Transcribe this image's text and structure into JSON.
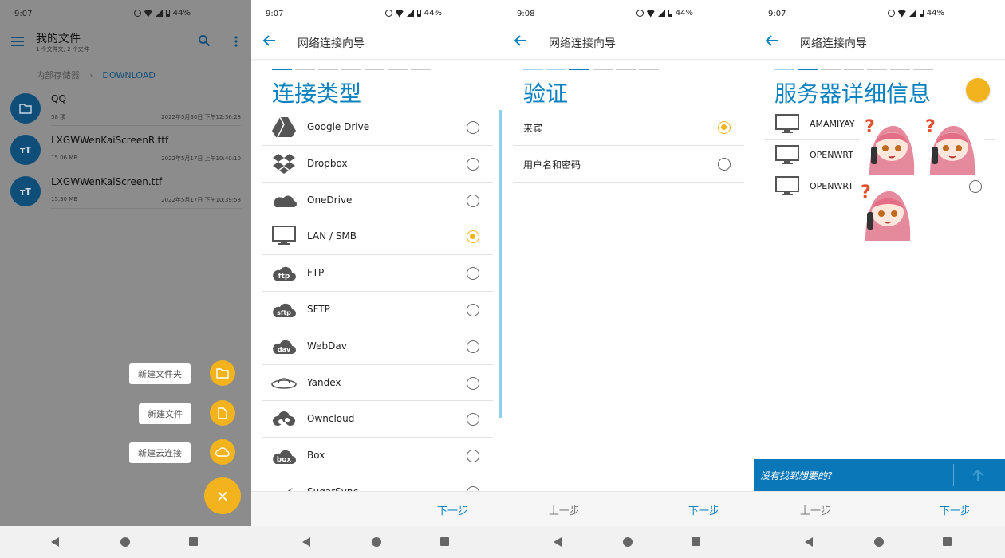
{
  "colors": {
    "accent": "#0a82c0",
    "fab": "#f2b31d",
    "hint_bar": "#0a78b8",
    "folder_icon": "#0e4e78"
  },
  "status": {
    "p1_time": "9:07",
    "p2_time": "9:07",
    "p3_time": "9:08",
    "p4_time": "9:07",
    "battery": "44%"
  },
  "panel1": {
    "title": "我的文件",
    "subtitle": "1 个文件夹, 2 个文件",
    "breadcrumb": {
      "root": "内部存储器",
      "current": "DOWNLOAD"
    },
    "files": [
      {
        "icon": "folder-icon",
        "name": "QQ",
        "meta": "58 项",
        "date": "2022年5月30日 下午12:36:28"
      },
      {
        "icon": "font-file-icon",
        "name": "LXGWWenKaiScreenR.ttf",
        "meta": "15.06 MB",
        "date": "2022年5月17日 上午10:40:10"
      },
      {
        "icon": "font-file-icon",
        "name": "LXGWWenKaiScreen.ttf",
        "meta": "15.30 MB",
        "date": "2022年5月17日 下午10:39:58"
      }
    ],
    "fab_menu": {
      "new_folder": "新建文件夹",
      "new_file": "新建文件",
      "new_cloud": "新建云连接",
      "close": "×"
    }
  },
  "wizard": {
    "title": "网络连接向导",
    "next": "下一步",
    "prev": "上一步"
  },
  "panel2": {
    "heading": "连接类型",
    "options": [
      {
        "icon": "google-drive-icon",
        "label": "Google Drive",
        "selected": false
      },
      {
        "icon": "dropbox-icon",
        "label": "Dropbox",
        "selected": false
      },
      {
        "icon": "onedrive-icon",
        "label": "OneDrive",
        "selected": false
      },
      {
        "icon": "monitor-icon",
        "label": "LAN / SMB",
        "selected": true
      },
      {
        "icon": "ftp-icon",
        "label": "FTP",
        "selected": false
      },
      {
        "icon": "sftp-icon",
        "label": "SFTP",
        "selected": false
      },
      {
        "icon": "webdav-icon",
        "label": "WebDav",
        "selected": false
      },
      {
        "icon": "yandex-icon",
        "label": "Yandex",
        "selected": false
      },
      {
        "icon": "owncloud-icon",
        "label": "Owncloud",
        "selected": false
      },
      {
        "icon": "box-icon",
        "label": "Box",
        "selected": false
      },
      {
        "icon": "sugarsync-icon",
        "label": "SugarSync",
        "selected": false
      }
    ]
  },
  "panel3": {
    "heading": "验证",
    "options": [
      {
        "label": "来宾",
        "selected": true
      },
      {
        "label": "用户名和密码",
        "selected": false
      }
    ]
  },
  "panel4": {
    "heading": "服务器详细信息",
    "servers": [
      {
        "label": "AMAMIYAY",
        "selected": false
      },
      {
        "label": "OPENWRT",
        "selected": false
      },
      {
        "label": "OPENWRT",
        "selected": false
      }
    ],
    "hint": "没有找到想要的?"
  }
}
